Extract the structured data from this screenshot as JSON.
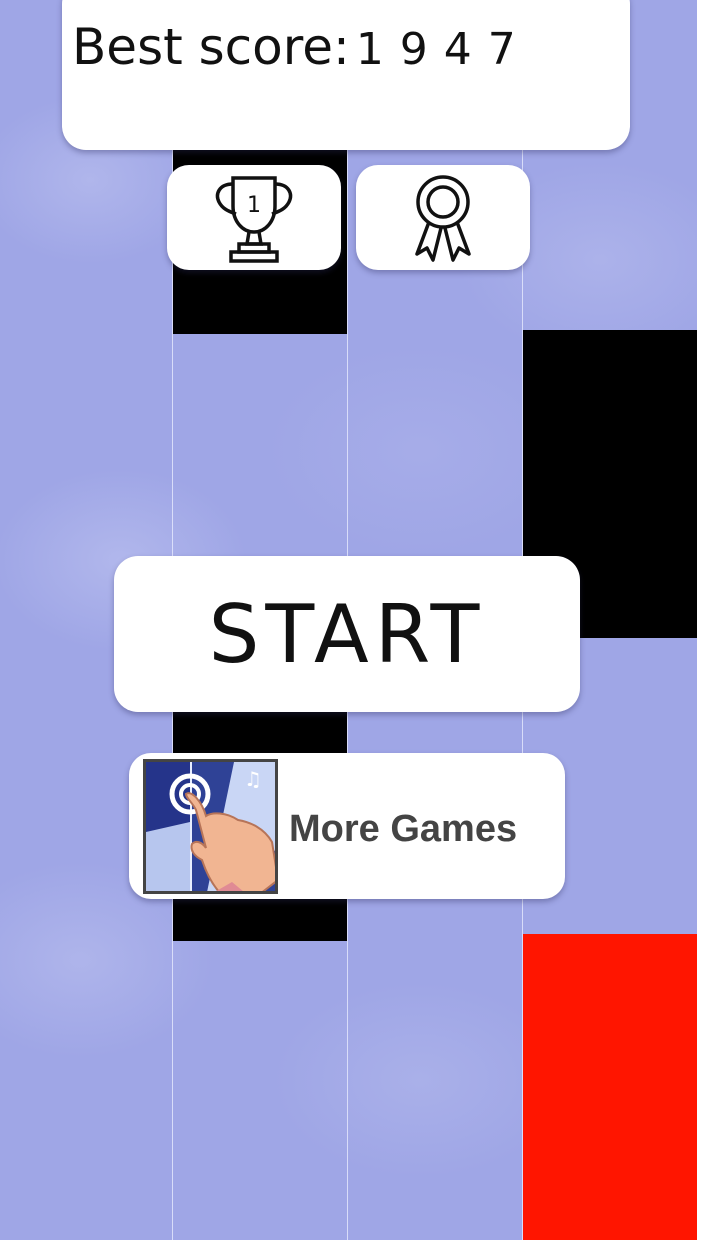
{
  "best_score": {
    "label": "Best score:",
    "value": "1947"
  },
  "buttons": {
    "start_label": "START",
    "more_games_label": "More Games",
    "leaderboard_icon": "trophy-icon",
    "achievements_icon": "ribbon-medal-icon"
  },
  "trophy_rank_label": "1",
  "tile_colors": {
    "black": "#000000",
    "missed": "#ff1500",
    "background": "#9fa6e6"
  }
}
